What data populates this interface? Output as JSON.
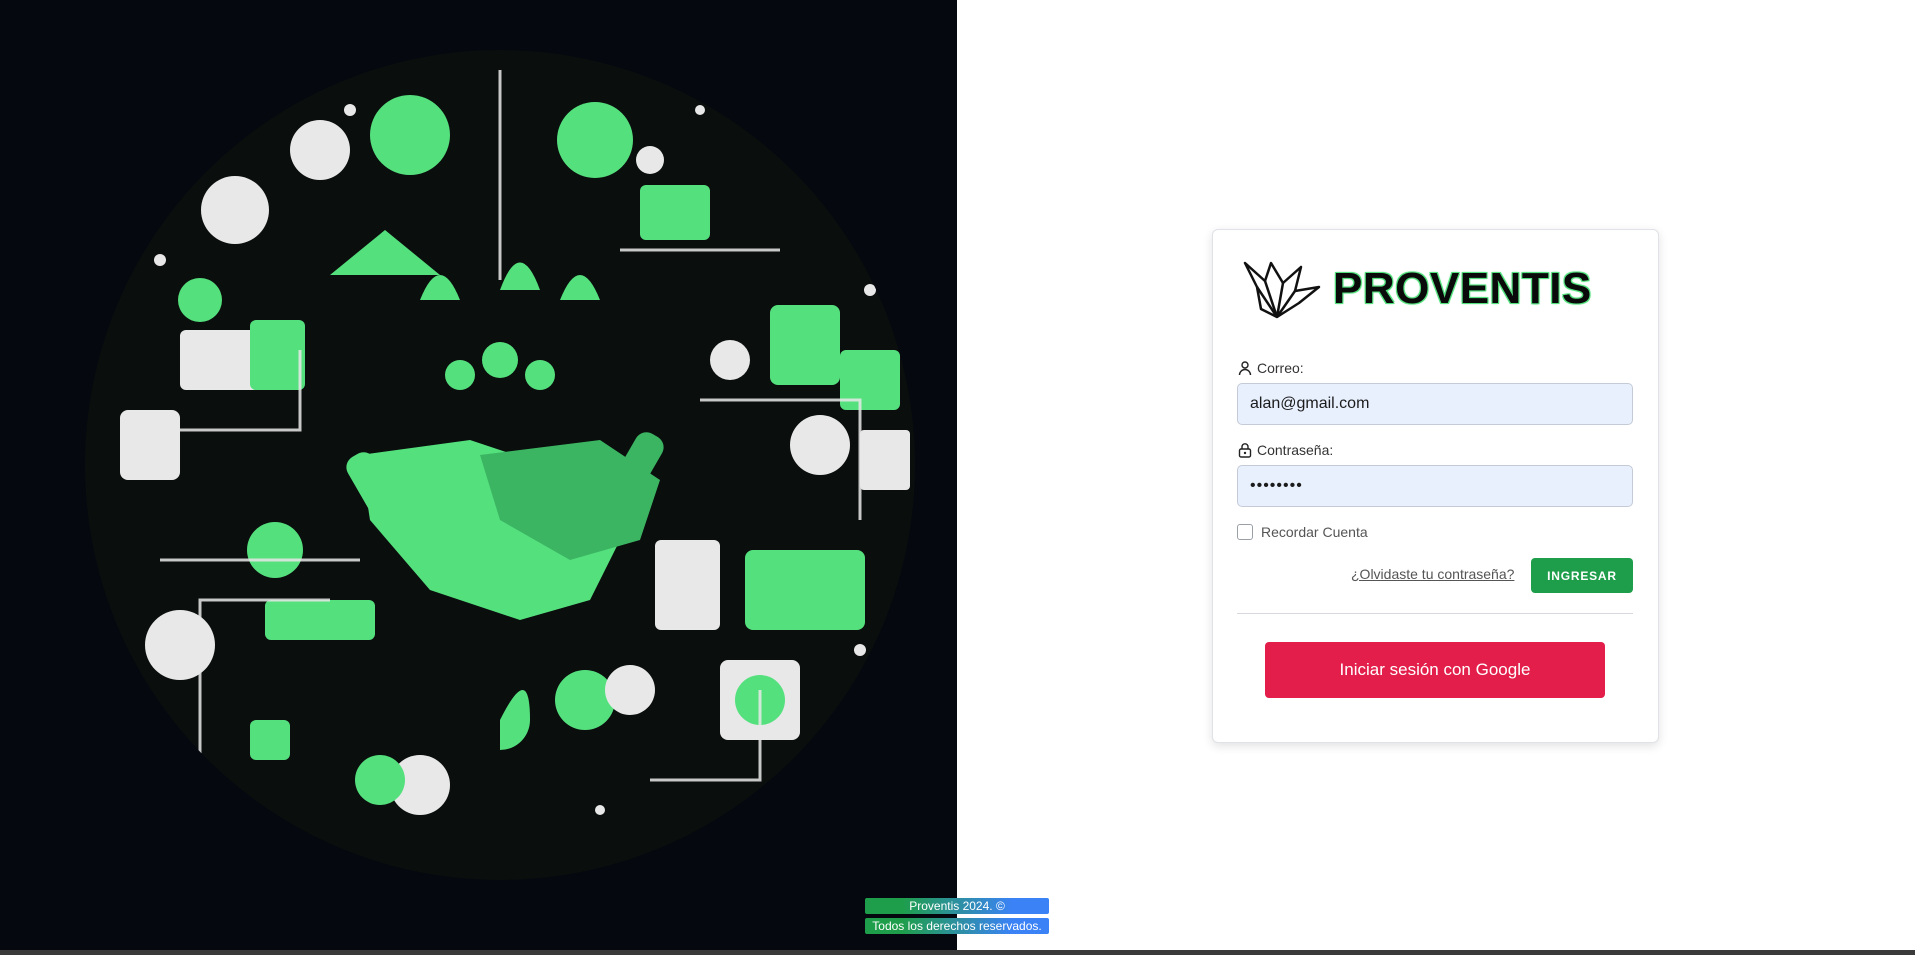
{
  "brand": {
    "name": "PROVENTIS",
    "accent": "#55e07e",
    "logo_icon": "origami-crane-icon"
  },
  "login": {
    "email_label": "Correo:",
    "email_icon": "user-icon",
    "email_value": "alan@gmail.com",
    "password_label": "Contraseña:",
    "password_icon": "lock-icon",
    "password_value": "••••••••",
    "remember_label": "Recordar Cuenta",
    "forgot_label": "¿Olvidaste tu contraseña?",
    "submit_label": "INGRESAR",
    "google_label": "Iniciar sesión con Google"
  },
  "footer": {
    "line1": "Proventis 2024. ©",
    "line2": "Todos los derechos reservados."
  },
  "colors": {
    "submit": "#1e9e4a",
    "google": "#e31e4a",
    "left_panel": "#05080f",
    "input_bg": "#e8f0fe"
  }
}
